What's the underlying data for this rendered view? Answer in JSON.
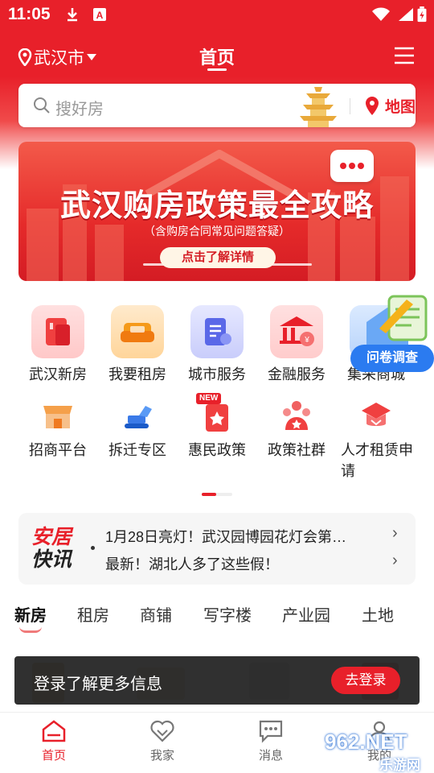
{
  "status_bar": {
    "time": "11:05"
  },
  "header": {
    "city": "武汉市",
    "title": "首页"
  },
  "search": {
    "placeholder": "搜好房",
    "map_label": "地图"
  },
  "banner": {
    "title": "武汉购房政策最全攻略",
    "subtitle": "（含购房合同常见问题答疑）",
    "cta": "点击了解详情"
  },
  "grid_row1": [
    {
      "label": "武汉新房",
      "icon": "building-icon"
    },
    {
      "label": "我要租房",
      "icon": "sofa-icon"
    },
    {
      "label": "城市服务",
      "icon": "document-icon"
    },
    {
      "label": "金融服务",
      "icon": "bank-icon"
    },
    {
      "label": "集采商城",
      "icon": "mall-icon"
    }
  ],
  "grid_row2": [
    {
      "label": "招商平台",
      "icon": "shop-icon"
    },
    {
      "label": "拆迁专区",
      "icon": "excavator-icon"
    },
    {
      "label": "惠民政策",
      "icon": "policy-icon",
      "badge": "NEW"
    },
    {
      "label": "政策社群",
      "icon": "community-icon"
    },
    {
      "label": "人才租赁申请",
      "icon": "graduation-icon"
    }
  ],
  "survey": {
    "label": "问卷调查"
  },
  "news": {
    "logo_top": "安居",
    "logo_bottom": "快讯",
    "items": [
      "1月28日亮灯！武汉园博园花灯会第…",
      "最新！湖北人多了这些假！"
    ]
  },
  "tabs": [
    "新房",
    "租房",
    "商铺",
    "写字楼",
    "产业园",
    "土地"
  ],
  "toast": {
    "message": "登录了解更多信息",
    "button": "去登录"
  },
  "bottom_nav": [
    {
      "label": "首页",
      "icon": "home-icon"
    },
    {
      "label": "我家",
      "icon": "heart-icon"
    },
    {
      "label": "消息",
      "icon": "message-icon"
    },
    {
      "label": "我的",
      "icon": "user-icon"
    }
  ],
  "watermark": {
    "big": "962.NET",
    "small": "乐游网"
  },
  "colors": {
    "brand_red": "#e8202a",
    "survey_blue": "#2b7bf0"
  }
}
